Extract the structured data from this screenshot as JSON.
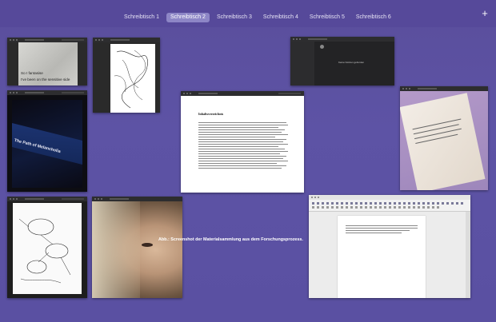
{
  "spaces_bar": {
    "tabs": [
      {
        "label": "Schreibtisch 1",
        "active": false
      },
      {
        "label": "Schreibtisch 2",
        "active": true
      },
      {
        "label": "Schreibtisch 3",
        "active": false
      },
      {
        "label": "Schreibtisch 4",
        "active": false
      },
      {
        "label": "Schreibtisch 5",
        "active": false
      },
      {
        "label": "Schreibtisch 6",
        "active": false
      }
    ],
    "add_label": "+"
  },
  "windows": {
    "photo_note": {
      "line1": "So I fantasise",
      "line2": "I've been on the sensitive side"
    },
    "book_cover": {
      "text": "The Path of Melancholia"
    },
    "dark_app": {
      "heading": "Keine Notizen gefunden"
    },
    "document": {
      "heading": "Inhaltsverzeichnis"
    }
  },
  "caption": "Abb.: Screenshot der Materialsammlung aus dem Forschungsprozess.",
  "colors": {
    "background": "#5a4e9c",
    "active_tab": "#8d86c6"
  }
}
